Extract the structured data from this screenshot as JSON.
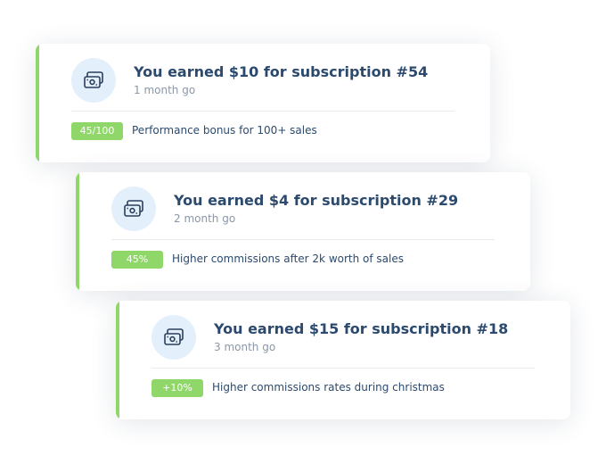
{
  "colors": {
    "accent": "#8fd768",
    "badge": "#8fd768",
    "icon_bg": "#e3f0fb",
    "icon_stroke": "#2a3f5c",
    "title": "#2c4a6e",
    "time": "#8a97a8",
    "desc": "#2c4a6e"
  },
  "cards": [
    {
      "icon": "money-icon",
      "title": "You earned $10 for subscription #54",
      "time": "1 month go",
      "badge": "45/100",
      "description": "Performance bonus for 100+ sales"
    },
    {
      "icon": "money-icon",
      "title": "You earned $4 for subscription #29",
      "time": "2 month go",
      "badge": "45%",
      "description": "Higher commissions after 2k worth of sales"
    },
    {
      "icon": "money-icon",
      "title": "You earned $15 for subscription #18",
      "time": "3 month go",
      "badge": "+10%",
      "description": "Higher commissions rates during christmas"
    }
  ]
}
